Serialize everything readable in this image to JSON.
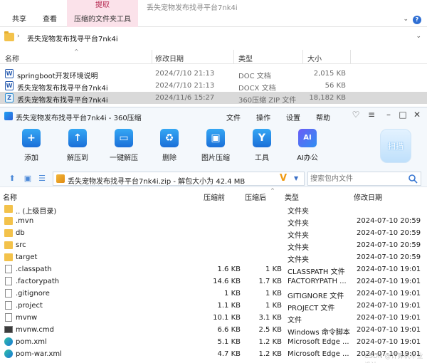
{
  "explorer": {
    "ribbon": {
      "context_title": "提取",
      "tabs": [
        "共享",
        "查看"
      ],
      "context_tab": "压缩的文件夹工具",
      "window_title": "丢失宠物发布找寻平台7nk4i"
    },
    "address": {
      "path": "丢失宠物发布找寻平台7nk4i"
    },
    "columns": {
      "name": "名称",
      "date": "修改日期",
      "type": "类型",
      "size": "大小"
    },
    "files": [
      {
        "icon": "W",
        "name": "springboot开发环境说明",
        "date": "2024/7/10 21:13",
        "type": "DOC 文档",
        "size": "2,015 KB"
      },
      {
        "icon": "W",
        "name": "丢失宠物发布找寻平台7nk4i",
        "date": "2024/7/10 21:13",
        "type": "DOCX 文档",
        "size": "56 KB"
      },
      {
        "icon": "Z",
        "name": "丢失宠物发布找寻平台7nk4i",
        "date": "2024/11/6 15:27",
        "type": "360压缩 ZIP 文件",
        "size": "18,182 KB"
      }
    ]
  },
  "zipwin": {
    "title": "丢失宠物发布找寻平台7nk4i - 360压缩",
    "menu": [
      "文件",
      "操作",
      "设置",
      "帮助"
    ],
    "toolbar": [
      {
        "label": "添加",
        "glyph": "+"
      },
      {
        "label": "解压到",
        "glyph": "↑"
      },
      {
        "label": "一键解压",
        "glyph": "▭"
      },
      {
        "label": "删除",
        "glyph": "♻"
      },
      {
        "label": "图片压缩",
        "glyph": "▣"
      },
      {
        "label": "工具",
        "glyph": "Y"
      },
      {
        "label": "AI办公",
        "glyph": "AI"
      }
    ],
    "scan_label": "扫描",
    "path_text": "丢失宠物发布找寻平台7nk4i.zip - 解包大小为 42.4 MB",
    "search_placeholder": "搜索包内文件",
    "columns": {
      "name": "名称",
      "packed": "压缩前",
      "compressed": "压缩后",
      "type": "类型",
      "modified": "修改日期"
    },
    "rows": [
      {
        "icon": "folder",
        "name": ".. (上级目录)",
        "before": "",
        "after": "",
        "type": "文件夹",
        "modified": ""
      },
      {
        "icon": "folder",
        "name": ".mvn",
        "before": "",
        "after": "",
        "type": "文件夹",
        "modified": "2024-07-10 20:59"
      },
      {
        "icon": "folder",
        "name": "db",
        "before": "",
        "after": "",
        "type": "文件夹",
        "modified": "2024-07-10 20:59"
      },
      {
        "icon": "folder",
        "name": "src",
        "before": "",
        "after": "",
        "type": "文件夹",
        "modified": "2024-07-10 20:59"
      },
      {
        "icon": "folder",
        "name": "target",
        "before": "",
        "after": "",
        "type": "文件夹",
        "modified": "2024-07-10 20:59"
      },
      {
        "icon": "file",
        "name": ".classpath",
        "before": "1.6 KB",
        "after": "1 KB",
        "type": "CLASSPATH 文件",
        "modified": "2024-07-10 19:01"
      },
      {
        "icon": "file",
        "name": ".factorypath",
        "before": "14.6 KB",
        "after": "1.7 KB",
        "type": "FACTORYPATH ...",
        "modified": "2024-07-10 19:01"
      },
      {
        "icon": "file",
        "name": ".gitignore",
        "before": "1 KB",
        "after": "1 KB",
        "type": "GITIGNORE 文件",
        "modified": "2024-07-10 19:01"
      },
      {
        "icon": "file",
        "name": ".project",
        "before": "1.1 KB",
        "after": "1 KB",
        "type": "PROJECT 文件",
        "modified": "2024-07-10 19:01"
      },
      {
        "icon": "file",
        "name": "mvnw",
        "before": "10.1 KB",
        "after": "3.1 KB",
        "type": "文件",
        "modified": "2024-07-10 19:01"
      },
      {
        "icon": "cmd",
        "name": "mvnw.cmd",
        "before": "6.6 KB",
        "after": "2.5 KB",
        "type": "Windows 命令脚本",
        "modified": "2024-07-10 19:01"
      },
      {
        "icon": "edge",
        "name": "pom.xml",
        "before": "5.1 KB",
        "after": "1.2 KB",
        "type": "Microsoft Edge ...",
        "modified": "2024-07-10 19:01"
      },
      {
        "icon": "edge",
        "name": "pom-war.xml",
        "before": "4.7 KB",
        "after": "1.2 KB",
        "type": "Microsoft Edge ...",
        "modified": "2024-07-10 19:01"
      }
    ],
    "watermark": "CSDN @计算机毕业设计"
  }
}
